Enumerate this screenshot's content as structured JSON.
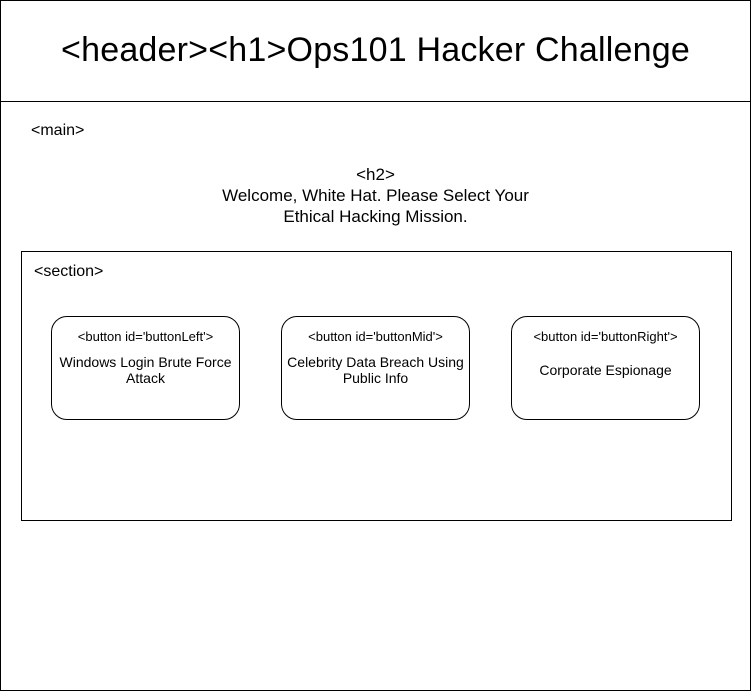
{
  "header": {
    "title": "<header><h1>Ops101 Hacker Challenge"
  },
  "main": {
    "label": "<main>",
    "h2": {
      "tag": "<h2>",
      "line1": "Welcome, White Hat. Please Select Your",
      "line2": "Ethical Hacking Mission."
    },
    "section": {
      "label": "<section>",
      "buttons": [
        {
          "id_label": "<button id='buttonLeft'>",
          "text": "Windows Login Brute Force Attack"
        },
        {
          "id_label": "<button id='buttonMid'>",
          "text": "Celebrity Data Breach Using Public Info"
        },
        {
          "id_label": "<button id='buttonRight'>",
          "text": "Corporate Espionage"
        }
      ]
    }
  }
}
